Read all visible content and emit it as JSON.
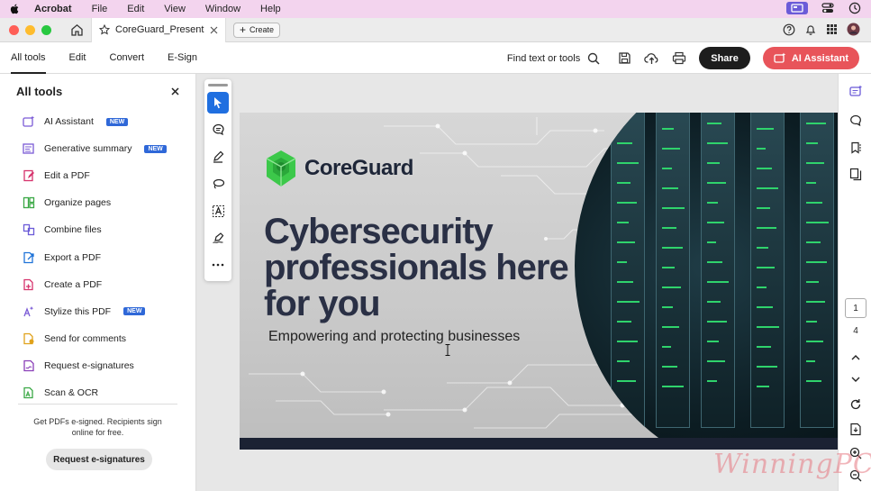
{
  "menubar": {
    "app": "Acrobat",
    "items": [
      "File",
      "Edit",
      "View",
      "Window",
      "Help"
    ]
  },
  "tabbar": {
    "doc_title": "CoreGuard_Presentati...",
    "create_label": "Create"
  },
  "toolbar": {
    "nav": [
      "All tools",
      "Edit",
      "Convert",
      "E-Sign"
    ],
    "find_label": "Find text or tools",
    "share_label": "Share",
    "ai_label": "AI Assistant"
  },
  "panel": {
    "title": "All tools",
    "tools": [
      {
        "label": "AI Assistant",
        "badge": "NEW",
        "icon": "ai-assistant-icon",
        "color": "#7b5bd6"
      },
      {
        "label": "Generative summary",
        "badge": "NEW",
        "icon": "generative-summary-icon",
        "color": "#7b5bd6"
      },
      {
        "label": "Edit a PDF",
        "badge": "",
        "icon": "edit-pdf-icon",
        "color": "#d6336c"
      },
      {
        "label": "Organize pages",
        "badge": "",
        "icon": "organize-pages-icon",
        "color": "#3aa845"
      },
      {
        "label": "Combine files",
        "badge": "",
        "icon": "combine-files-icon",
        "color": "#6b5bd8"
      },
      {
        "label": "Export a PDF",
        "badge": "",
        "icon": "export-pdf-icon",
        "color": "#1f73d8"
      },
      {
        "label": "Create a PDF",
        "badge": "",
        "icon": "create-pdf-icon",
        "color": "#d6336c"
      },
      {
        "label": "Stylize this PDF",
        "badge": "NEW",
        "icon": "stylize-pdf-icon",
        "color": "#7b5bd6"
      },
      {
        "label": "Send for comments",
        "badge": "",
        "icon": "send-comments-icon",
        "color": "#e0a21b"
      },
      {
        "label": "Request e-signatures",
        "badge": "",
        "icon": "request-esign-icon",
        "color": "#8a3fb8"
      },
      {
        "label": "Scan & OCR",
        "badge": "",
        "icon": "scan-ocr-icon",
        "color": "#3aa845"
      }
    ],
    "promo": "Get PDFs e-signed. Recipients sign online for free.",
    "request_button": "Request e-signatures"
  },
  "slide": {
    "logo_text": "CoreGuard",
    "headline": "Cybersecurity professionals here for you",
    "subline": "Empowering and protecting businesses"
  },
  "rail": {
    "current_page": "1",
    "total_pages": "4"
  },
  "watermark": "WinningPC",
  "colors": {
    "menubar_bg": "#f3d4ee",
    "ai_button": "#e8545a",
    "accent_blue": "#1f6fe0",
    "logo_green": "#3cc84a"
  }
}
